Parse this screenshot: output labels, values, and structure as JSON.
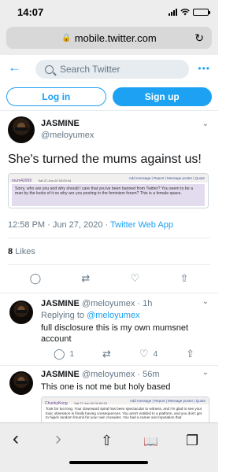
{
  "status_bar": {
    "time": "14:07"
  },
  "browser": {
    "url": "mobile.twitter.com"
  },
  "header": {
    "search_placeholder": "Search Twitter",
    "more": "•••"
  },
  "auth": {
    "login_label": "Log in",
    "signup_label": "Sign up"
  },
  "main_tweet": {
    "name": "JASMINE",
    "handle": "@meloyumex",
    "text": "She's turned the mums against us!",
    "embed": {
      "user": "mum42069",
      "date": "Sat 27-Jun-20 03:00:44",
      "actions": "Add message | Report | Message poster | Quote",
      "body": "Sorry, who are you and why should I care that you've been banned from Twitter? You seem to be a man by the looks of it so why are you posting in the feminism forum? This is a female space."
    },
    "timestamp": "12:58 PM · Jun 27, 2020 · ",
    "source": "Twitter Web App",
    "likes_count": "8",
    "likes_label": "Likes"
  },
  "replies": [
    {
      "name": "JASMINE",
      "handle": "@meloyumex · 1h",
      "replying_prefix": "Replying to ",
      "replying_to": "@meloyumex",
      "text": "full disclosure this is my own mumsnet account",
      "reply_count": "1",
      "like_count": "4"
    },
    {
      "name": "JASMINE",
      "handle": "@meloyumex · 56m",
      "text": "This one is not me but holy based",
      "embed": {
        "user": "ChunkyKong",
        "date": "Sat 27-Jun-20 04:09:43",
        "actions": "Add message | Report | Message poster | Quote",
        "body": "Took far too long. Your downward spiral has been spectacular to witness, and I'm glad to see your toxic obsession is finally having consequences. You aren't entitled to a platform, and you don't get to hijack random forums for your own crusades. You had a career and reputation that"
      }
    }
  ],
  "icons": {
    "back": "←",
    "caret": "⌄",
    "reply": "◯",
    "retweet": "⇄",
    "like": "♡",
    "share": "⇧",
    "tb_back": "‹",
    "tb_forward": "›",
    "tb_share": "⇧",
    "tb_bookmarks": "📖",
    "tb_tabs": "❐"
  },
  "colors": {
    "accent": "#1da1f2",
    "muted": "#657786"
  }
}
